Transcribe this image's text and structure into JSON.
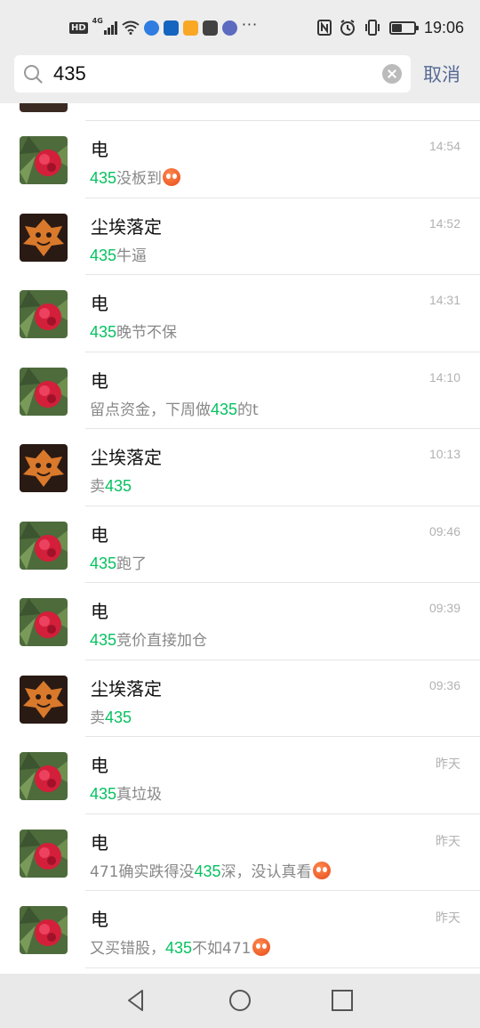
{
  "status_bar": {
    "time": "19:06",
    "left_icons": [
      "hd-icon",
      "signal-4g-icon",
      "wifi-icon",
      "app-icon",
      "app-icon",
      "app-icon",
      "app-icon",
      "app-icon",
      "more-dots-icon"
    ],
    "right_icons": [
      "nfc-icon",
      "alarm-icon",
      "vibrate-icon",
      "battery-icon"
    ],
    "battery_level": 0.45
  },
  "search": {
    "query": "435",
    "cancel_label": "取消"
  },
  "colors": {
    "highlight": "#07c160",
    "cancel": "#576b95",
    "background": "#ededed"
  },
  "results": [
    {
      "name": "电",
      "time": "14:54",
      "avatar": "flower",
      "parts": [
        {
          "t": "435",
          "hl": true
        },
        {
          "t": "没板到"
        }
      ],
      "emoji": true
    },
    {
      "name": "尘埃落定",
      "time": "14:52",
      "avatar": "leaf",
      "parts": [
        {
          "t": "435",
          "hl": true
        },
        {
          "t": "牛逼"
        }
      ],
      "emoji": false
    },
    {
      "name": "电",
      "time": "14:31",
      "avatar": "flower",
      "parts": [
        {
          "t": "435",
          "hl": true
        },
        {
          "t": "晚节不保"
        }
      ],
      "emoji": false
    },
    {
      "name": "电",
      "time": "14:10",
      "avatar": "flower",
      "parts": [
        {
          "t": "留点资金，下周做"
        },
        {
          "t": "435",
          "hl": true
        },
        {
          "t": "的t"
        }
      ],
      "emoji": false
    },
    {
      "name": "尘埃落定",
      "time": "10:13",
      "avatar": "leaf",
      "parts": [
        {
          "t": "卖"
        },
        {
          "t": "435",
          "hl": true
        }
      ],
      "emoji": false
    },
    {
      "name": "电",
      "time": "09:46",
      "avatar": "flower",
      "parts": [
        {
          "t": "435",
          "hl": true
        },
        {
          "t": "跑了"
        }
      ],
      "emoji": false
    },
    {
      "name": "电",
      "time": "09:39",
      "avatar": "flower",
      "parts": [
        {
          "t": "435",
          "hl": true
        },
        {
          "t": "竞价直接加仓"
        }
      ],
      "emoji": false
    },
    {
      "name": "尘埃落定",
      "time": "09:36",
      "avatar": "leaf",
      "parts": [
        {
          "t": "卖"
        },
        {
          "t": "435",
          "hl": true
        }
      ],
      "emoji": false
    },
    {
      "name": "电",
      "time": "昨天",
      "avatar": "flower",
      "parts": [
        {
          "t": "435",
          "hl": true
        },
        {
          "t": "真垃圾"
        }
      ],
      "emoji": false
    },
    {
      "name": "电",
      "time": "昨天",
      "avatar": "flower",
      "parts": [
        {
          "t": "471确实跌得没"
        },
        {
          "t": "435",
          "hl": true
        },
        {
          "t": "深，没认真看"
        }
      ],
      "emoji": true
    },
    {
      "name": "电",
      "time": "昨天",
      "avatar": "flower",
      "parts": [
        {
          "t": "又买错股，"
        },
        {
          "t": "435",
          "hl": true
        },
        {
          "t": "不如471"
        }
      ],
      "emoji": true
    }
  ],
  "navbar": [
    "back-icon",
    "home-icon",
    "recents-icon"
  ]
}
